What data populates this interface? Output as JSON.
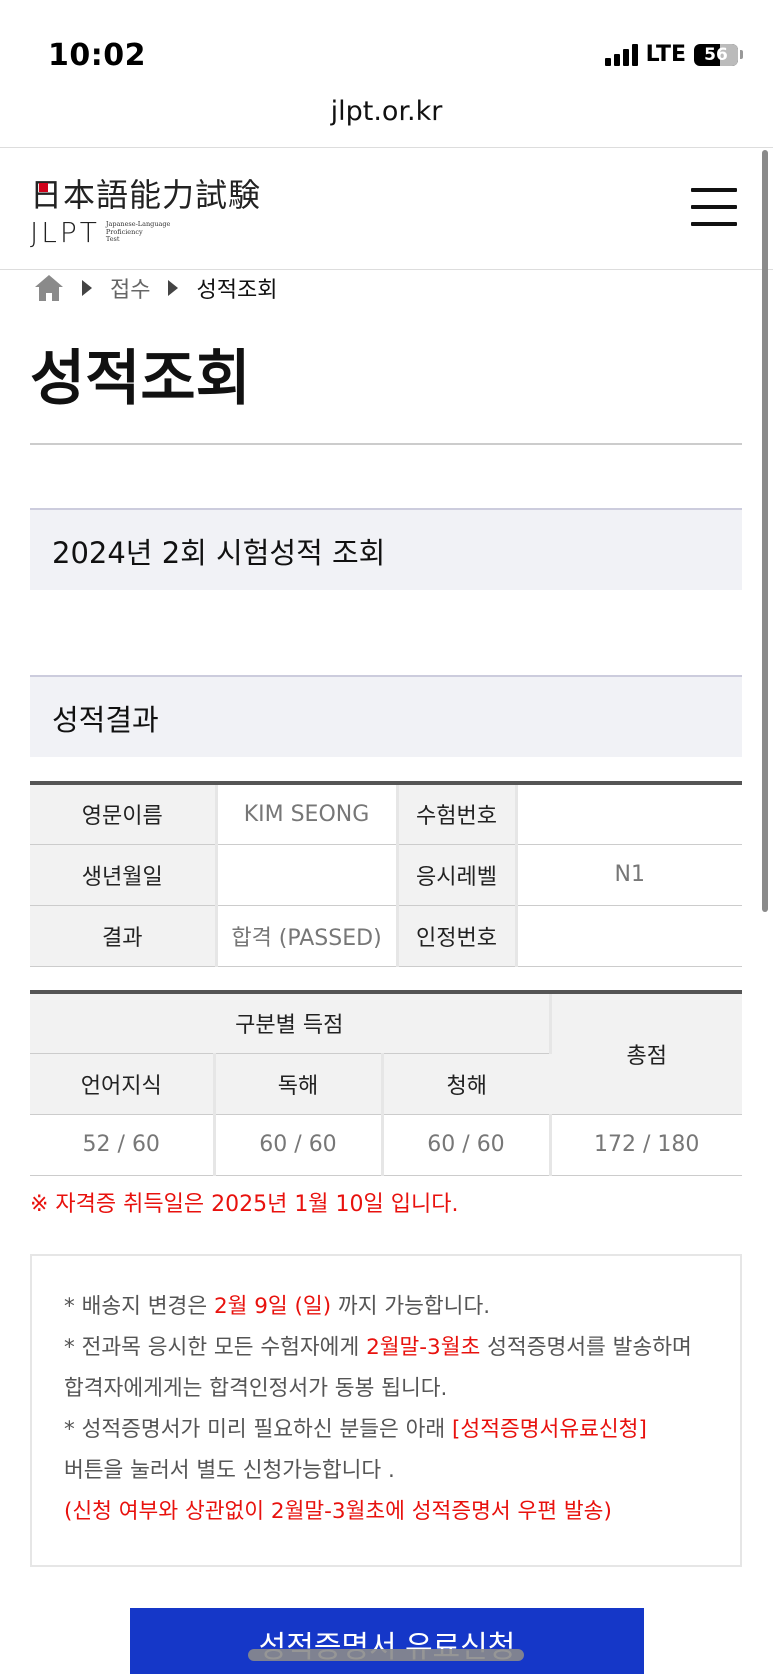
{
  "status_bar": {
    "time": "10:02",
    "network": "LTE",
    "battery": "56"
  },
  "browser": {
    "url": "jlpt.or.kr"
  },
  "header": {
    "logo_jp": "日本語能力試験",
    "logo_en": "JLPT",
    "logo_sub": [
      "Japanese-Language",
      "Proficiency",
      "Test"
    ]
  },
  "breadcrumb": {
    "items": [
      "접수",
      "성적조회"
    ]
  },
  "page_title": "성적조회",
  "exam_section": "2024년 2회 시험성적 조회",
  "result_section": "성적결과",
  "info_table": {
    "name_label": "영문이름",
    "name_value": "KIM SEONG",
    "exam_no_label": "수험번호",
    "exam_no_value": "",
    "birth_label": "생년월일",
    "birth_value": "",
    "level_label": "응시레벨",
    "level_value": "N1",
    "result_label": "결과",
    "result_value": "합격 (PASSED)",
    "cert_no_label": "인정번호",
    "cert_no_value": ""
  },
  "score_table": {
    "section_header": "구분별 득점",
    "total_header": "총점",
    "columns": [
      "언어지식",
      "독해",
      "청해"
    ],
    "scores": [
      "52 / 60",
      "60 / 60",
      "60 / 60"
    ],
    "total": "172 / 180"
  },
  "notice_red": "※ 자격증 취득일은 2025년 1월 10일 입니다.",
  "info_box": {
    "line1_pre": "* 배송지 변경은 ",
    "line1_red": "2월 9일 (일)",
    "line1_post": " 까지 가능합니다.",
    "line2_pre": "* 전과목 응시한 모든 수험자에게 ",
    "line2_red": "2월말-3월초",
    "line2_post": " 성적증명서를 발송하며",
    "line3": "합격자에게게는 합격인정서가 동봉 됩니다.",
    "line4_pre": "* 성적증명서가 미리 필요하신 분들은 아래 ",
    "line4_red": "[성적증명서유료신청]",
    "line5": "버튼을 눌러서 별도 신청가능합니다 .",
    "line6_red": "(신청 여부와 상관없이 2월말-3월초에 성적증명서 우편 발송)"
  },
  "cta": {
    "label": "성적증명서 유료신청"
  },
  "colors": {
    "accent_red": "#e8110d",
    "button_blue": "#1537c8",
    "section_bg": "#f1f2f6"
  }
}
